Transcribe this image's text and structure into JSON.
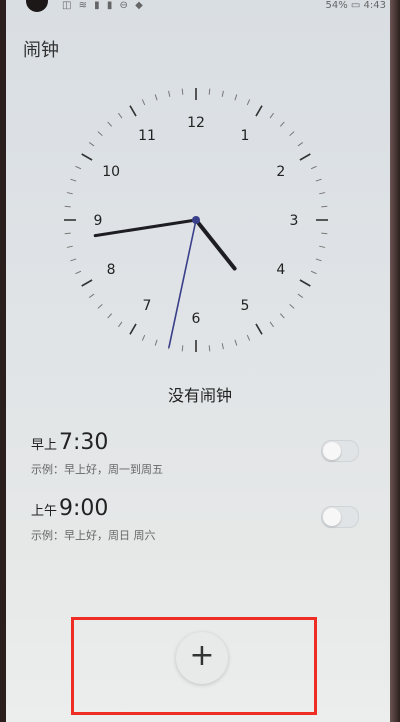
{
  "status_bar": {
    "icons": "◫ ≋ ▮ ▮ ⊖ ◆",
    "right": "54% ▭ 4:43"
  },
  "app": {
    "title": "闹钟"
  },
  "clock": {
    "numerals": [
      "12",
      "1",
      "2",
      "3",
      "4",
      "5",
      "6",
      "7",
      "8",
      "9",
      "10",
      "11"
    ],
    "time": {
      "hours": 4,
      "minutes": 43,
      "seconds": 32
    }
  },
  "empty_state": "没有闹钟",
  "alarms": [
    {
      "prefix": "早上",
      "time": "7:30",
      "description": "示例：早上好，周一到周五",
      "enabled": false
    },
    {
      "prefix": "上午",
      "time": "9:00",
      "description": "示例：早上好，周日 周六",
      "enabled": false
    }
  ],
  "add_button": {
    "label": "+"
  },
  "colors": {
    "highlight": "#ee2d24",
    "second_hand": "#3a3f8a",
    "hands": "#1e1e22"
  }
}
